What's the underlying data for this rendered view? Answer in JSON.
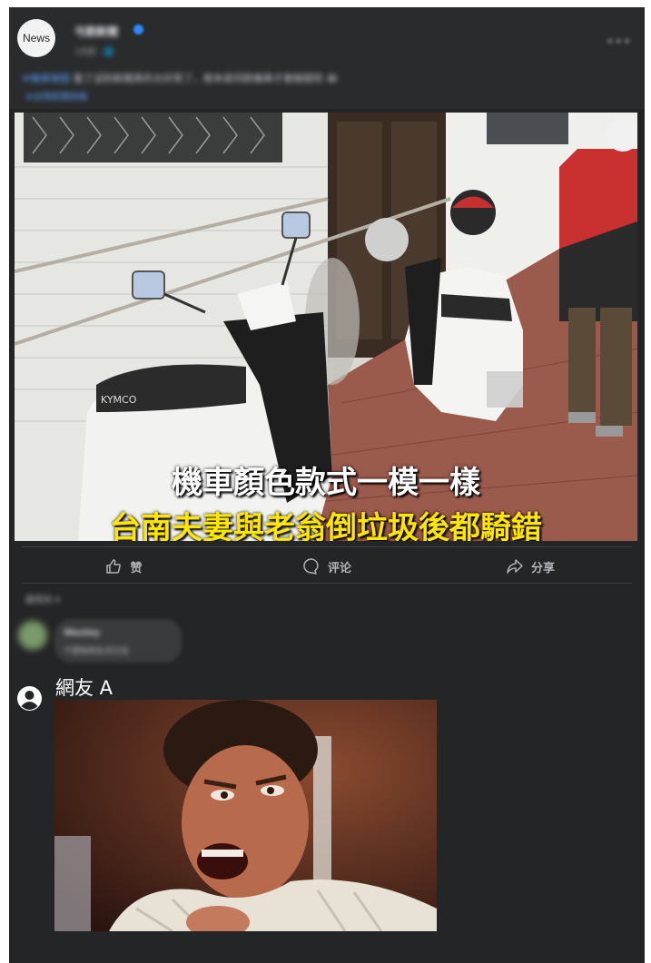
{
  "post": {
    "avatar_text": "News",
    "page_name": "弓箭新聞",
    "timestamp": "1天前 · 🌐",
    "caption": {
      "highlight": "#機車搞錯",
      "text": "看了這則新聞真的太好笑了，根本是同款機車才會騎錯呀 😂",
      "link": "#台南新聞快報"
    },
    "photo": {
      "overlay_line1": "機車顏色款式一模一樣",
      "overlay_line2": "台南夫妻與老翁倒垃圾後都騎錯",
      "scooter_brand": "KYMCO"
    }
  },
  "actions": [
    {
      "label": "赞",
      "icon": "thumbs-up-icon"
    },
    {
      "label": "评论",
      "icon": "comment-icon"
    },
    {
      "label": "分享",
      "icon": "share-icon"
    }
  ],
  "comments": {
    "sort_label": "最相关 ▾",
    "blurred_comment": {
      "name": "Wesley",
      "text": "不要騎車亂丟垃圾"
    },
    "reply": {
      "user": "網友 A",
      "icon": "user-avatar-icon"
    }
  },
  "colors": {
    "card_bg": "#242526",
    "overlay_white": "#ffffff",
    "overlay_yellow": "#ffe600",
    "action_text": "#b0b3b8"
  }
}
